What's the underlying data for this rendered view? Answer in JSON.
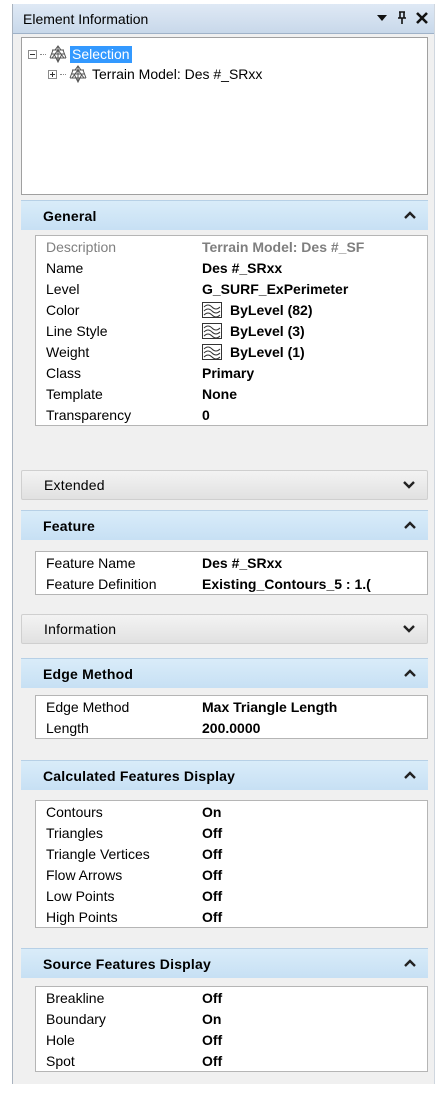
{
  "titlebar": {
    "title": "Element Information",
    "icons": [
      "dropdown-arrow-icon",
      "pin-icon",
      "close-icon"
    ]
  },
  "tree": {
    "root": {
      "label": "Selection",
      "expanded": true,
      "icon": "terrain-model-icon"
    },
    "child": {
      "label": "Terrain Model: Des #_SRxx",
      "expanded": false,
      "icon": "terrain-model-icon"
    }
  },
  "sections": {
    "general": {
      "title": "General",
      "rows": [
        {
          "label": "Description",
          "value": "Terrain Model: Des #_SF"
        },
        {
          "label": "Name",
          "value": "Des #_SRxx"
        },
        {
          "label": "Level",
          "value": "G_SURF_ExPerimeter"
        },
        {
          "label": "Color",
          "value": "ByLevel (82)"
        },
        {
          "label": "Line Style",
          "value": "ByLevel (3)"
        },
        {
          "label": "Weight",
          "value": "ByLevel (1)"
        },
        {
          "label": "Class",
          "value": "Primary"
        },
        {
          "label": "Template",
          "value": "None"
        },
        {
          "label": "Transparency",
          "value": "0"
        }
      ]
    },
    "extended": {
      "title": "Extended"
    },
    "feature": {
      "title": "Feature",
      "rows": [
        {
          "label": "Feature Name",
          "value": "Des #_SRxx"
        },
        {
          "label": "Feature Definition",
          "value": "Existing_Contours_5 : 1.("
        }
      ]
    },
    "information": {
      "title": "Information"
    },
    "edge_method": {
      "title": "Edge Method",
      "rows": [
        {
          "label": "Edge Method",
          "value": "Max Triangle Length"
        },
        {
          "label": "Length",
          "value": "200.0000"
        }
      ]
    },
    "calculated": {
      "title": "Calculated Features Display",
      "rows": [
        {
          "label": "Contours",
          "value": "On"
        },
        {
          "label": "Triangles",
          "value": "Off"
        },
        {
          "label": "Triangle Vertices",
          "value": "Off"
        },
        {
          "label": "Flow Arrows",
          "value": "Off"
        },
        {
          "label": "Low Points",
          "value": "Off"
        },
        {
          "label": "High Points",
          "value": "Off"
        }
      ]
    },
    "source": {
      "title": "Source Features Display",
      "rows": [
        {
          "label": "Breakline",
          "value": "Off"
        },
        {
          "label": "Boundary",
          "value": "On"
        },
        {
          "label": "Hole",
          "value": "Off"
        },
        {
          "label": "Spot",
          "value": "Off"
        }
      ]
    }
  },
  "colors": {
    "selection": "#3399ff",
    "section_header": "#d2e7f7",
    "dim_text": "#7f7f7f"
  }
}
